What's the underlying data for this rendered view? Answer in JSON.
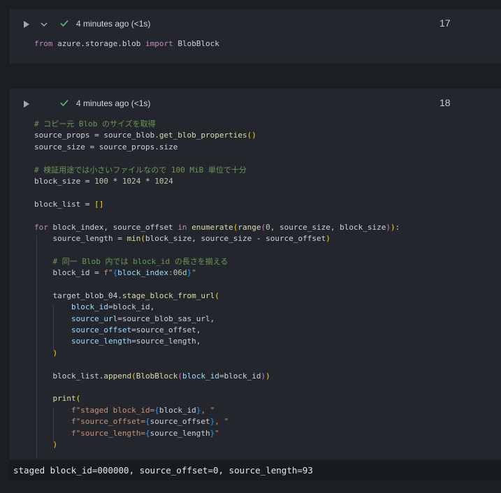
{
  "cells": [
    {
      "status_text": "4 minutes ago (<1s)",
      "execution_count": "17",
      "code_lines": [
        "from azure.storage.blob import BlobBlock"
      ]
    },
    {
      "status_text": "4 minutes ago (<1s)",
      "execution_count": "18",
      "code_lines": [
        "# コピー元 Blob のサイズを取得",
        "source_props = source_blob.get_blob_properties()",
        "source_size = source_props.size",
        "",
        "# 検証用途では小さいファイルなので 100 MiB 単位で十分",
        "block_size = 100 * 1024 * 1024",
        "",
        "block_list = []",
        "",
        "for block_index, source_offset in enumerate(range(0, source_size, block_size)):",
        "    source_length = min(block_size, source_size - source_offset)",
        "",
        "    # 同一 Blob 内では block_id の長さを揃える",
        "    block_id = f\"{block_index:06d}\"",
        "",
        "    target_blob_04.stage_block_from_url(",
        "        block_id=block_id,",
        "        source_url=source_blob_sas_url,",
        "        source_offset=source_offset,",
        "        source_length=source_length,",
        "    )",
        "",
        "    block_list.append(BlobBlock(block_id=block_id))",
        "",
        "    print(",
        "        f\"staged block_id={block_id}, \"",
        "        f\"source_offset={source_offset}, \"",
        "        f\"source_length={source_length}\"",
        "    )"
      ]
    }
  ],
  "output": "staged block_id=000000, source_offset=0, source_length=93",
  "colors": {
    "success_check": "#4ec97a",
    "cell_bg": "#23272d",
    "page_bg": "#1b1f24"
  },
  "icons": [
    "run-icon",
    "collapse-chevron-icon",
    "success-check-icon"
  ]
}
